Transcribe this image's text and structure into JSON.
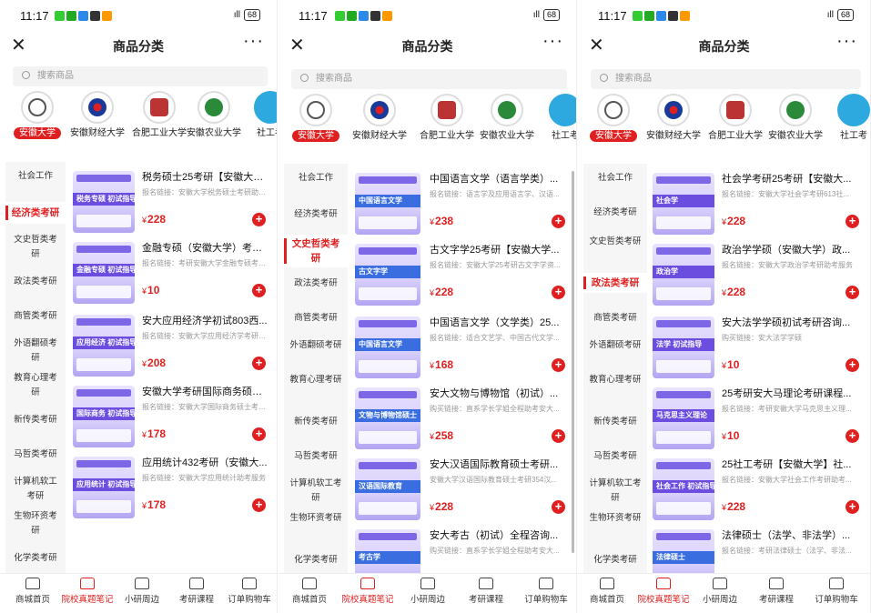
{
  "status": {
    "time": "11:17",
    "battery": "68",
    "signal": "4G"
  },
  "header": {
    "title": "商品分类"
  },
  "search": {
    "placeholder": "搜索商品"
  },
  "universities": [
    "安徽大学",
    "安徽财经大学",
    "合肥工业大学",
    "安徽农业大学",
    "社工考"
  ],
  "categories": [
    "社会工作",
    "经济类考研",
    "文史哲类考研",
    "政法类考研",
    "商管类考研",
    "外语翻硕考研",
    "教育心理考研",
    "新传类考研",
    "马哲类考研",
    "计算机软工考研",
    "生物环资考研",
    "化学类考研"
  ],
  "tabs": [
    "商城首页",
    "院校真题笔记",
    "小研周边",
    "考研课程",
    "订单购物车"
  ],
  "colors": {
    "accent": "#e02020"
  },
  "panel1": {
    "products": [
      {
        "title": "税务硕士25考研【安徽大学】...",
        "desc": "报名链接：安徽大学税务硕士考研助考服务",
        "price": "228",
        "cover": "税务专硕 初试指导"
      },
      {
        "title": "金融专硕（安徽大学）考研...",
        "desc": "报名链接：考研安徽大学金融专硕考研助考",
        "price": "10",
        "cover": "金融专硕 初试指导"
      },
      {
        "title": "安大应用经济学初试803西...",
        "desc": "报名链接：安徽大学应用经济学考研助考",
        "price": "208",
        "cover": "应用经济 初试指导"
      },
      {
        "title": "安徽大学考研国际商务硕士...",
        "desc": "报名链接：安徽大学国际商务硕士考研助考",
        "price": "178",
        "cover": "国际商务 初试指导"
      },
      {
        "title": "应用统计432考研（安徽大...",
        "desc": "报名链接：安徽大学应用统计助考服务",
        "price": "178",
        "cover": "应用统计 初试指导"
      }
    ]
  },
  "panel2": {
    "products": [
      {
        "title": "中国语言文学（语言学类）...",
        "desc": "报名链接：语言学及应用语言学、汉语...",
        "price": "238",
        "cover": "中国语言文学"
      },
      {
        "title": "古文字学25考研【安徽大学...",
        "desc": "报名链接：安徽大学25考研古文字学资...",
        "price": "228",
        "cover": "古文字学"
      },
      {
        "title": "中国语言文学（文学类）25...",
        "desc": "报名链接：适合文艺学、中国古代文学...",
        "price": "168",
        "cover": "中国语言文学"
      },
      {
        "title": "安大文物与博物馆（初试）...",
        "desc": "购买链接：直系学长学姐全程助考安大...",
        "price": "258",
        "cover": "文物与博物馆硕士"
      },
      {
        "title": "安大汉语国际教育硕士考研...",
        "desc": "安徽大学汉语国际教育硕士考研354汉...",
        "price": "228",
        "cover": "汉语国际教育"
      },
      {
        "title": "安大考古（初试）全程咨询...",
        "desc": "购买链接：直系学长学姐全程助考安大...",
        "price": "",
        "cover": "考古学"
      }
    ]
  },
  "panel3": {
    "products": [
      {
        "title": "社会学考研25考研【安徽大...",
        "desc": "报名链接：安徽大学社会学考研613社...",
        "price": "228",
        "cover": "社会学"
      },
      {
        "title": "政治学学硕（安徽大学）政...",
        "desc": "报名链接：安徽大学政治学考研助考服务",
        "price": "228",
        "cover": "政治学"
      },
      {
        "title": "安大法学学硕初试考研咨询...",
        "desc": "购买链接：安大法学学硕",
        "price": "10",
        "cover": "法学 初试指导"
      },
      {
        "title": "25考研安大马理论考研课程...",
        "desc": "报名链接：考研安徽大学马克思主义理...",
        "price": "10",
        "cover": "马克思主义理论"
      },
      {
        "title": "25社工考研【安徽大学】社...",
        "desc": "报名链接：安徽大学社会工作考研助考...",
        "price": "228",
        "cover": "社会工作 初试指导"
      },
      {
        "title": "法律硕士（法学、非法学）...",
        "desc": "报名链接：考研法律硕士（法学、非法...",
        "price": "",
        "cover": "法律硕士"
      }
    ]
  }
}
